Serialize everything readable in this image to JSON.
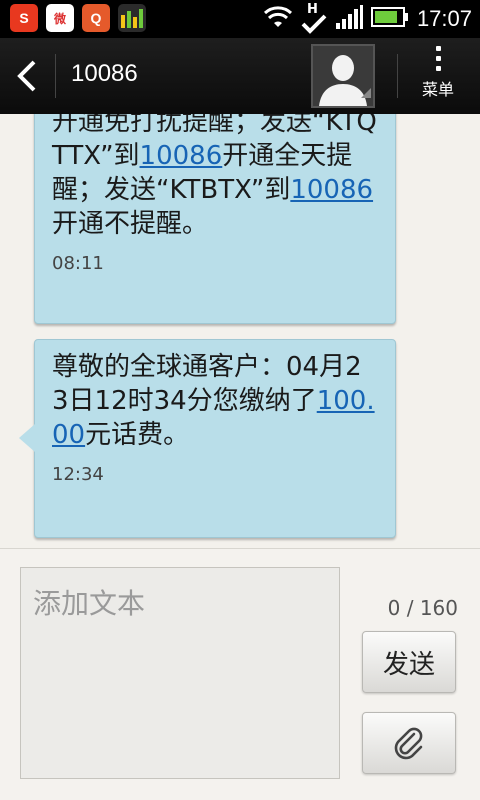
{
  "status_bar": {
    "time": "17:07",
    "network_type": "H",
    "icons": [
      "app-s-icon",
      "weibo-icon",
      "qq-icon",
      "stock-app-icon",
      "wifi-icon",
      "data-h-icon",
      "signal-icon",
      "battery-icon"
    ]
  },
  "header": {
    "title": "10086",
    "menu_label": "菜单"
  },
  "messages": [
    {
      "segments": [
        {
          "text": "开通免打扰提醒；发送“KTQTTX”到",
          "link": false
        },
        {
          "text": "10086",
          "link": true
        },
        {
          "text": "开通全天提醒；发送“KTBTX”到",
          "link": false
        },
        {
          "text": "10086",
          "link": true
        },
        {
          "text": "开通不提醒。",
          "link": false
        }
      ],
      "time": "08:11"
    },
    {
      "segments": [
        {
          "text": "尊敬的全球通客户：04月23日12时34分您缴纳了",
          "link": false
        },
        {
          "text": "100.00",
          "link": true
        },
        {
          "text": "元话费。",
          "link": false
        }
      ],
      "time": "12:34"
    }
  ],
  "compose": {
    "placeholder": "添加文本",
    "counter": "0 / 160",
    "send_label": "发送"
  },
  "colors": {
    "bubble": "#b9dee9",
    "link": "#1764b5",
    "header": "#111111",
    "background": "#f3f1ec"
  }
}
